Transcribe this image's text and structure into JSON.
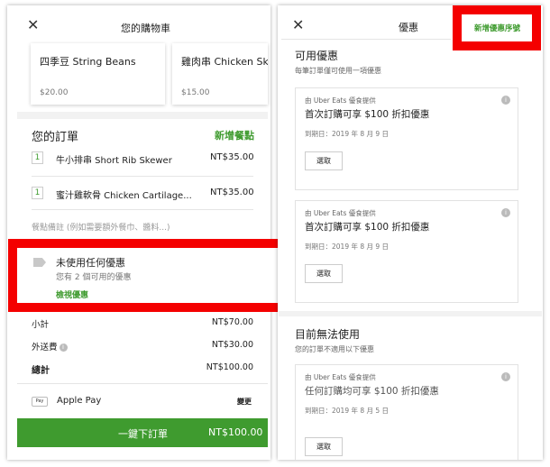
{
  "cart": {
    "title": "您的購物車",
    "recommendations": [
      {
        "name": "四季豆 String Beans",
        "price": "$20.00"
      },
      {
        "name": "雞肉串 Chicken Ske",
        "price": "$15.00"
      }
    ],
    "order_title": "您的訂單",
    "add_item": "新增餐點",
    "items": [
      {
        "qty": "1",
        "name": "牛小排串 Short Rib Skewer",
        "price": "NT$35.00"
      },
      {
        "qty": "1",
        "name": "蜜汁雞軟骨 Chicken Cartilage...",
        "price": "NT$35.00"
      }
    ],
    "note_placeholder": "餐點備註 (例如需要額外餐巾、醬料...)",
    "promo": {
      "title": "未使用任何優惠",
      "subtitle": "您有 2 個可用的優惠",
      "link": "檢視優惠",
      "icon": "tag-icon"
    },
    "summary": [
      {
        "label": "小計",
        "value": "NT$70.00",
        "info": false,
        "bold": false
      },
      {
        "label": "外送費",
        "value": "NT$30.00",
        "info": true,
        "bold": false
      },
      {
        "label": "總計",
        "value": "NT$100.00",
        "info": false,
        "bold": true
      }
    ],
    "payment": {
      "badge": "Pay",
      "method": "Apple Pay",
      "change": "變更"
    },
    "order_button": {
      "label": "一鍵下訂單",
      "amount": "NT$100.00"
    }
  },
  "promotions": {
    "title": "優惠",
    "add_code": "新增優惠序號",
    "available_title": "可用優惠",
    "available_sub": "每筆訂單僅可使用一項優惠",
    "offers": [
      {
        "provider": "由 Uber Eats 優食提供",
        "title": "首次訂購可享 $100 折扣優惠",
        "expiry": "到期日：2019 年 8 月 9 日",
        "select": "選取"
      },
      {
        "provider": "由 Uber Eats 優食提供",
        "title": "首次訂購可享 $100 折扣優惠",
        "expiry": "到期日：2019 年 8 月 9 日",
        "select": "選取"
      }
    ],
    "unavailable_title": "目前無法使用",
    "unavailable_sub": "您的訂單不適用以下優惠",
    "unavailable_offers": [
      {
        "provider": "由 Uber Eats 優食提供",
        "title": "任何訂購均可享 $100 折扣優惠",
        "expiry": "到期日：2019 年 8 月 5 日",
        "select": "選取"
      }
    ]
  },
  "colors": {
    "accent": "#3f9b2f",
    "highlight": "#f40000"
  }
}
